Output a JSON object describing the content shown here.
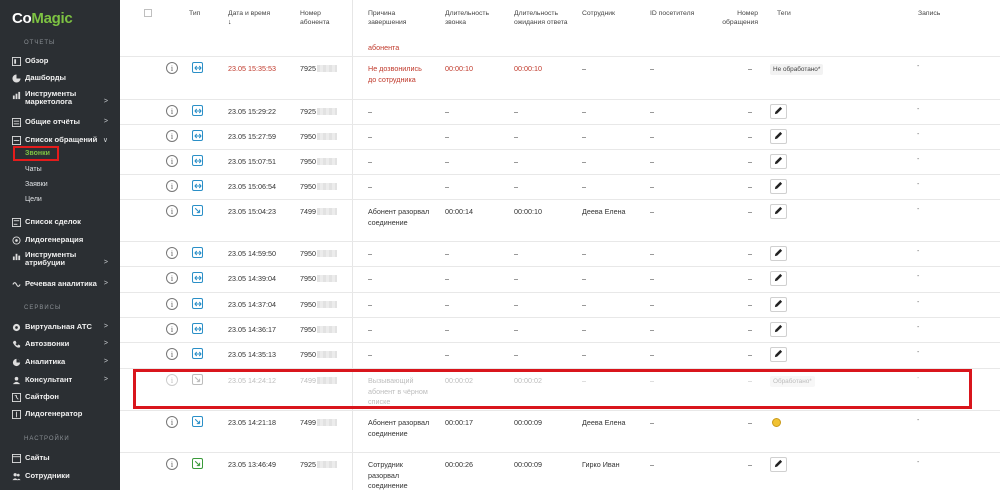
{
  "brand": {
    "logo_part1": "Co",
    "logo_part2": "Magic",
    "accent": "#7dc242"
  },
  "sidebar": {
    "section_reports": "ОТЧЕТЫ",
    "section_services": "СЕРВИСЫ",
    "section_settings": "НАСТРОЙКИ",
    "items": {
      "overview": "Обзор",
      "dashboards": "Дашборды",
      "marketing_tools": "Инструменты маркетолога",
      "general_reports": "Общие отчёты",
      "appeals_list": "Список обращений",
      "calls": "Звонки",
      "chats": "Чаты",
      "requests": "Заявки",
      "goals": "Цели",
      "deals_list": "Список сделок",
      "leadgen": "Лидогенерация",
      "attribution_tools": "Инструменты атрибуции",
      "speech_analytics": "Речевая аналитика",
      "virtual_pbx": "Виртуальная АТС",
      "autocalls": "Автозвонки",
      "analytics": "Аналитика",
      "consultant": "Консультант",
      "sitephone": "Сайтфон",
      "leadgenerator": "Лидогенератор",
      "sites": "Сайты",
      "employees": "Сотрудники"
    },
    "chevron_right": ">",
    "chevron_down": "∨"
  },
  "table": {
    "headers": {
      "type": "Тип",
      "datetime": "Дата и время",
      "subscriber": "Номер абонента",
      "end_reason": "Причина завершения",
      "call_duration": "Длительность звонка",
      "wait_duration": "Длительность ожидания ответа",
      "employee": "Сотрудник",
      "visitor_id": "ID посетителя",
      "referral": "Номер обращения",
      "tags": "Теги",
      "record": "Запись"
    },
    "sort_arrow": "↓",
    "info_glyph": "i",
    "dash": "–",
    "record_dash": "-",
    "partial_top": "абонента",
    "rows": [
      {
        "datetime": "23.05 15:35:53",
        "number": "7925",
        "reason": "Не дозвонились до сотрудника",
        "call": "00:00:10",
        "wait": "00:00:10",
        "employee": "–",
        "visitor": "–",
        "referral": "–",
        "tag": "Не обработано*",
        "red": true
      },
      {
        "datetime": "23.05 15:29:22",
        "number": "7925",
        "reason": "–",
        "call": "–",
        "wait": "–",
        "employee": "–",
        "visitor": "–",
        "referral": "–"
      },
      {
        "datetime": "23.05 15:27:59",
        "number": "7950",
        "reason": "–",
        "call": "–",
        "wait": "–",
        "employee": "–",
        "visitor": "–",
        "referral": "–"
      },
      {
        "datetime": "23.05 15:07:51",
        "number": "7950",
        "reason": "–",
        "call": "–",
        "wait": "–",
        "employee": "–",
        "visitor": "–",
        "referral": "–"
      },
      {
        "datetime": "23.05 15:06:54",
        "number": "7950",
        "reason": "–",
        "call": "–",
        "wait": "–",
        "employee": "–",
        "visitor": "–",
        "referral": "–"
      },
      {
        "datetime": "23.05 15:04:23",
        "number": "7499",
        "reason": "Абонент разорвал соединение",
        "call": "00:00:14",
        "wait": "00:00:10",
        "employee": "Деева Елена",
        "visitor": "–",
        "referral": "–"
      },
      {
        "datetime": "23.05 14:59:50",
        "number": "7950",
        "reason": "–",
        "call": "–",
        "wait": "–",
        "employee": "–",
        "visitor": "–",
        "referral": "–"
      },
      {
        "datetime": "23.05 14:39:04",
        "number": "7950",
        "reason": "–",
        "call": "–",
        "wait": "–",
        "employee": "–",
        "visitor": "–",
        "referral": "–"
      },
      {
        "datetime": "23.05 14:37:04",
        "number": "7950",
        "reason": "–",
        "call": "–",
        "wait": "–",
        "employee": "–",
        "visitor": "–",
        "referral": "–"
      },
      {
        "datetime": "23.05 14:36:17",
        "number": "7950",
        "reason": "–",
        "call": "–",
        "wait": "–",
        "employee": "–",
        "visitor": "–",
        "referral": "–"
      },
      {
        "datetime": "23.05 14:35:13",
        "number": "7950",
        "reason": "–",
        "call": "–",
        "wait": "–",
        "employee": "–",
        "visitor": "–",
        "referral": "–"
      },
      {
        "datetime": "23.05 14:24:12",
        "number": "7499",
        "reason": "Вызывающий абонент в чёрном списке",
        "call": "00:00:02",
        "wait": "00:00:02",
        "employee": "–",
        "visitor": "–",
        "referral": "–",
        "tag": "Обработано*"
      },
      {
        "datetime": "23.05 14:21:18",
        "number": "7499",
        "reason": "Абонент разорвал соединение",
        "call": "00:00:17",
        "wait": "00:00:09",
        "employee": "Деева Елена",
        "visitor": "–",
        "referral": "–"
      },
      {
        "datetime": "23.05 13:46:49",
        "number": "7925",
        "reason": "Сотрудник разорвал соединение",
        "call": "00:00:26",
        "wait": "00:00:09",
        "employee": "Гирко Иван",
        "visitor": "–",
        "referral": "–"
      }
    ]
  },
  "colors": {
    "sidebar_bg": "#2b2f33",
    "red_text": "#c0392b",
    "highlight": "#d9151c",
    "type_blue": "#2a8fc7",
    "type_green": "#3a9a3a"
  }
}
